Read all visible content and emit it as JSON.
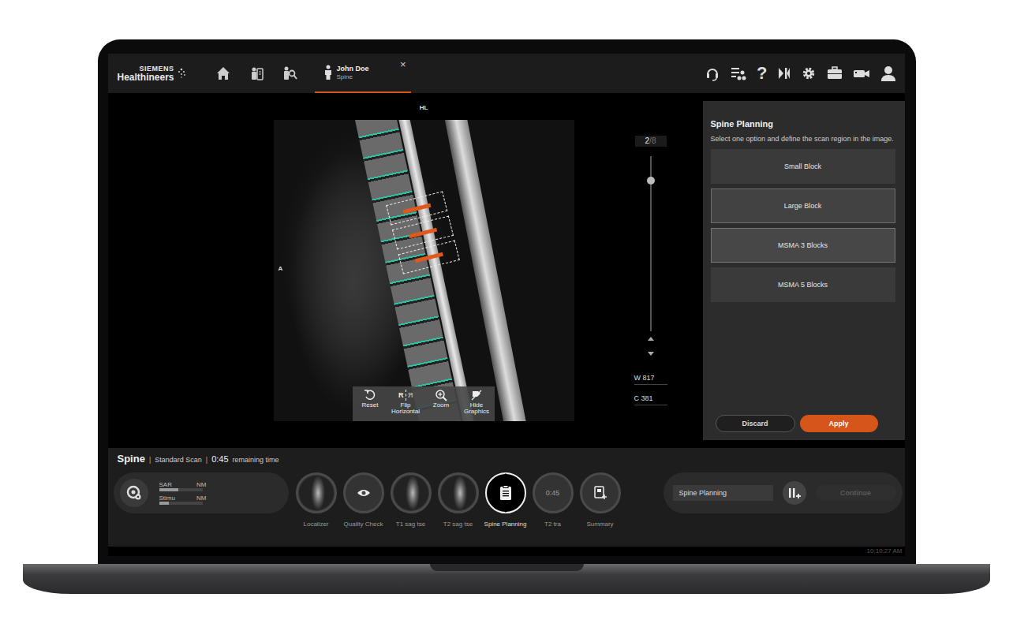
{
  "header": {
    "brand": {
      "line1": "SIEMENS",
      "line2": "Healthineers"
    },
    "patient_tab": {
      "name": "John Doe",
      "exam": "Spine",
      "close": "×",
      "selected": true
    },
    "help": "?"
  },
  "viewer": {
    "orientation_top": "HL",
    "orientation_left": "A",
    "slice": {
      "current": "2",
      "total": "/8",
      "level": 0.14
    },
    "window": {
      "label": "W",
      "value": "817"
    },
    "center": {
      "label": "C",
      "value": "381"
    },
    "tools": [
      {
        "label": "Reset",
        "kind": "reset"
      },
      {
        "label": "Flip Horizontal",
        "kind": "flip",
        "glyph": "R"
      },
      {
        "label": "Zoom",
        "kind": "zoom"
      },
      {
        "label": "Hide Graphics",
        "kind": "hide"
      }
    ]
  },
  "panel": {
    "title": "Spine Planning",
    "description": "Select one option and define the scan region in the image.",
    "options": [
      {
        "label": "Small Block",
        "selected": false,
        "hovered": false
      },
      {
        "label": "Large Block",
        "selected": true,
        "hovered": false
      },
      {
        "label": "MSMA 3 Blocks",
        "selected": false,
        "hovered": true
      },
      {
        "label": "MSMA 5 Blocks",
        "selected": false,
        "hovered": false
      }
    ],
    "discard": "Discard",
    "apply": "Apply"
  },
  "status": {
    "exam": "Spine",
    "separator": "|",
    "protocol": "Standard Scan",
    "remaining": "0:45",
    "remaining_label": "remaining time"
  },
  "meters": [
    {
      "label": "SAR",
      "value": "NM",
      "level": 0.45
    },
    {
      "label": "Stimu",
      "value": "NM",
      "level": 0.22
    }
  ],
  "steps": [
    {
      "label": "Localizer",
      "kind": "thumbnail",
      "selected": false
    },
    {
      "label": "Quality Check",
      "kind": "check",
      "selected": false
    },
    {
      "label": "T1 sag tse",
      "kind": "thumbnail",
      "selected": false
    },
    {
      "label": "T2 sag tse",
      "kind": "thumbnail",
      "selected": false
    },
    {
      "label": "Spine Planning",
      "kind": "planning",
      "selected": true
    },
    {
      "label": "T2 tra",
      "kind": "timer",
      "timer": "0:45",
      "selected": false
    },
    {
      "label": "Summary",
      "kind": "summary",
      "selected": false
    }
  ],
  "action": {
    "field": "Spine Planning",
    "continue": "Continue",
    "continue_disabled": true
  },
  "clock": "10:10:27 AM"
}
